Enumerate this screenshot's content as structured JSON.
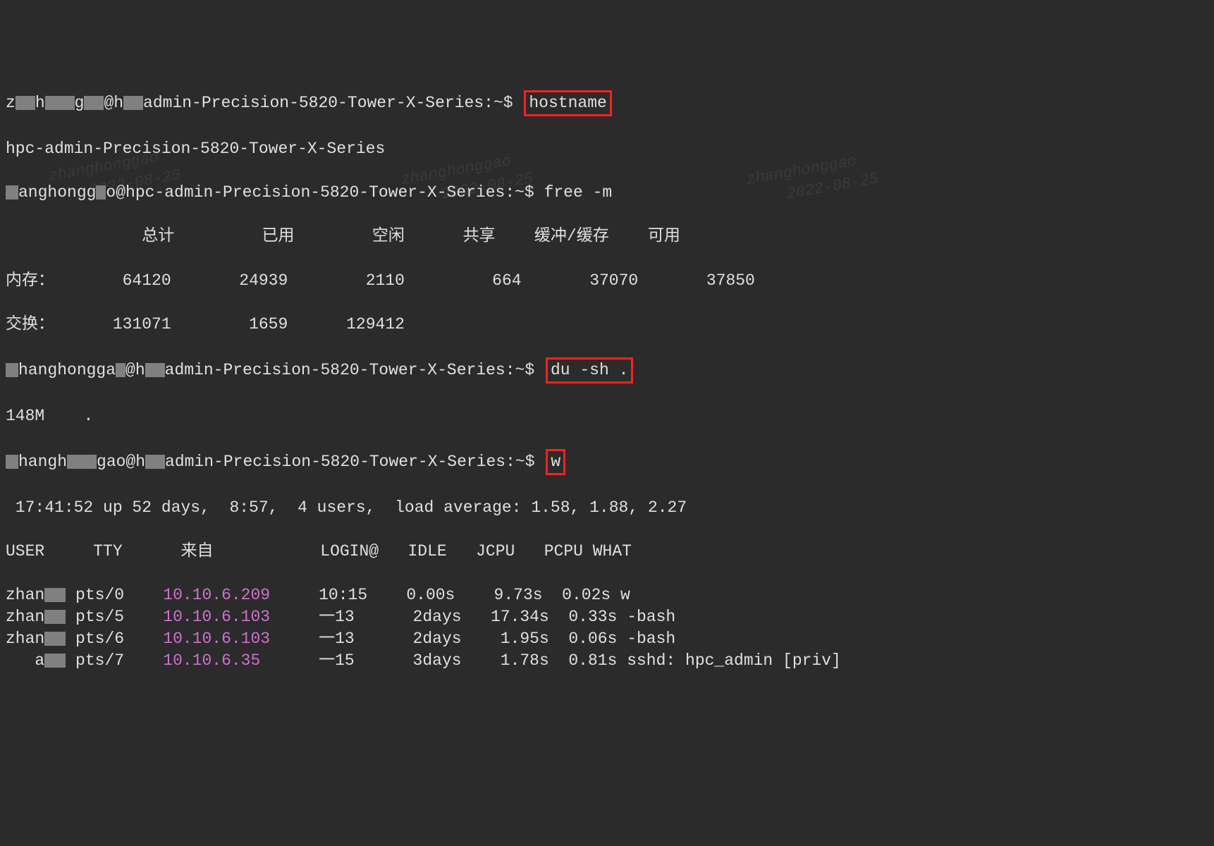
{
  "hostname_fq": "hpc-admin-Precision-5820-Tower-X-Series",
  "user_masked": "zhanghonggao",
  "prompt_suffix": ":~$",
  "cmd1": "hostname",
  "cmd1_output": "hpc-admin-Precision-5820-Tower-X-Series",
  "cmd2": "free -m",
  "free_header": "              总计         已用        空闲      共享    缓冲/缓存    可用",
  "free_mem_label": "内存：",
  "free_mem_total": "64120",
  "free_mem_used": "24939",
  "free_mem_free": "2110",
  "free_mem_shared": "664",
  "free_mem_buff": "37070",
  "free_mem_avail": "37850",
  "free_swap_label": "交换：",
  "free_swap_total": "131071",
  "free_swap_used": "1659",
  "free_swap_free": "129412",
  "cmd3": "du -sh .",
  "du_size": "148M",
  "du_path": ".",
  "cmd4": "w",
  "w_uptime": " 17:41:52 up 52 days,  8:57,  4 users,  load average: 1.58, 1.88, 2.27",
  "w_header": "USER     TTY      来自           LOGIN@   IDLE   JCPU   PCPU WHAT",
  "w_rows": [
    {
      "user": "zhang   ",
      "tty": "pts/0",
      "from": "10.10.6.209",
      "login": "10:15",
      "idle": "0.00s",
      "jcpu": "9.73s",
      "pcpu": "0.02s",
      "what": "w"
    },
    {
      "user": "zhan    ",
      "tty": "pts/5",
      "from": "10.10.6.103",
      "login": "一13",
      "idle": "2days",
      "jcpu": "17.34s",
      "pcpu": "0.33s",
      "what": "-bash"
    },
    {
      "user": "zhan    ",
      "tty": "pts/6",
      "from": "10.10.6.103",
      "login": "一13",
      "idle": "2days",
      "jcpu": "1.95s",
      "pcpu": "0.06s",
      "what": "-bash"
    },
    {
      "user": "   a    ",
      "tty": "pts/7",
      "from": "10.10.6.35 ",
      "login": "一15",
      "idle": "3days",
      "jcpu": "1.78s",
      "pcpu": "0.81s",
      "what": "sshd: hpc_admin [priv]"
    }
  ],
  "watermark_text": "zhanghonggao\n    2022-08-25"
}
